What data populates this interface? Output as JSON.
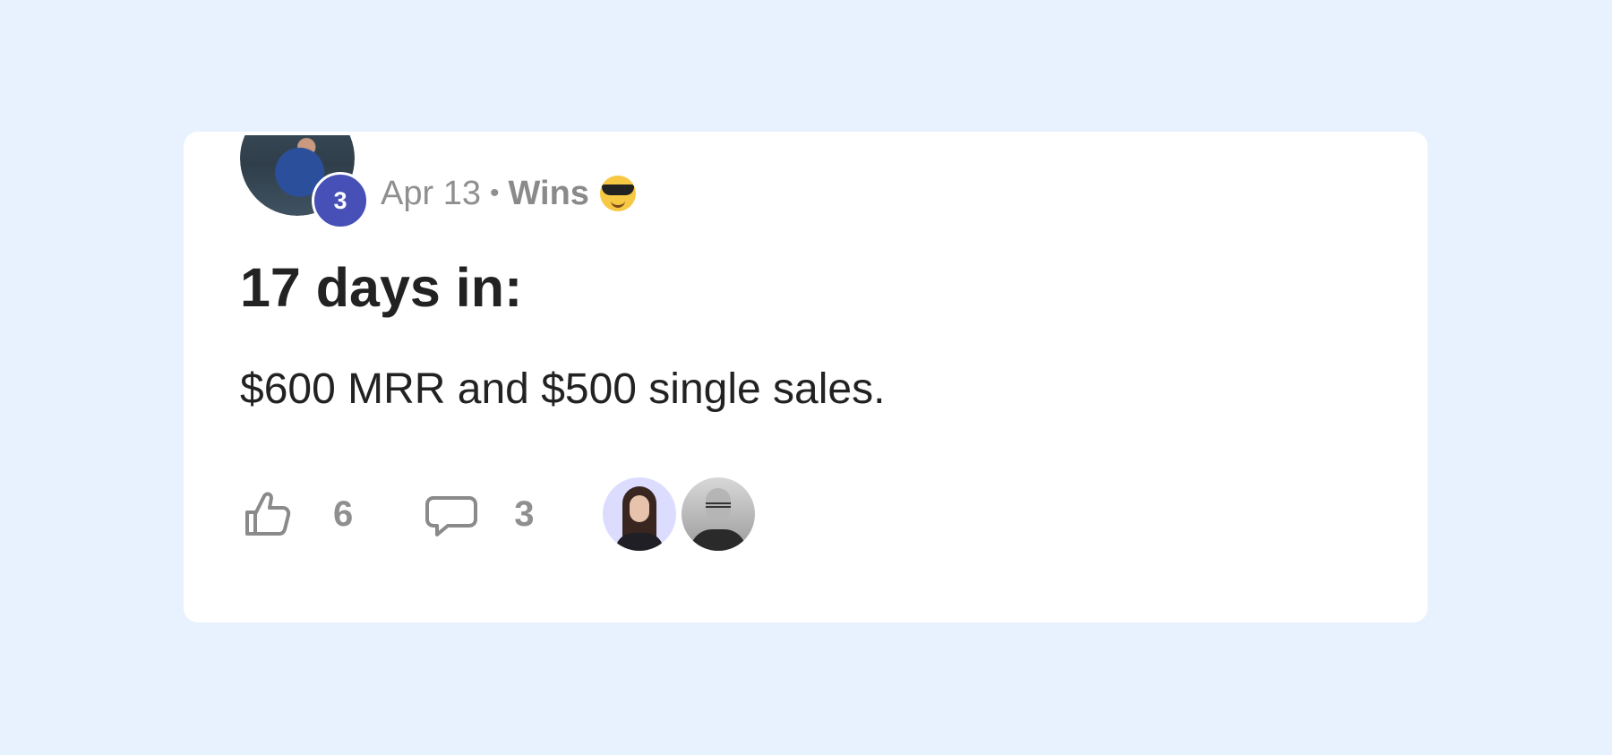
{
  "post": {
    "author_level": "3",
    "date": "Apr 13",
    "separator": "•",
    "category": "Wins",
    "category_emoji_icon": "sunglasses-emoji-icon",
    "title": "17 days in:",
    "body": "$600 MRR and $500 single sales."
  },
  "actions": {
    "likes_count": "6",
    "comments_count": "3",
    "like_icon": "thumbs-up-icon",
    "comment_icon": "speech-bubble-icon"
  },
  "colors": {
    "page_background": "#e7f2fe",
    "card_background": "#ffffff",
    "badge": "#4650b6",
    "muted_text": "#8f8f8f",
    "main_text": "#222222"
  }
}
